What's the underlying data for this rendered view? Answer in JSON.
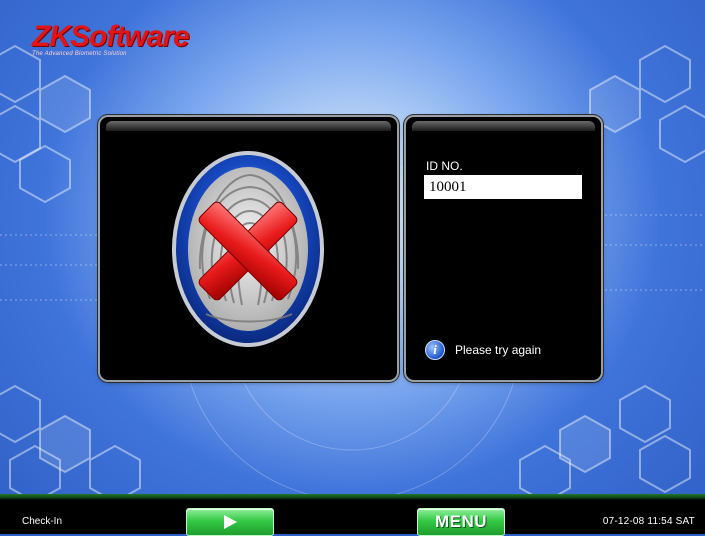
{
  "brand": {
    "name": "ZKSoftware",
    "tagline": "The Advanced Biometric Solution"
  },
  "result_panel": {
    "state": "verification-failed",
    "icon": "fingerprint-reject-icon"
  },
  "id_panel": {
    "label": "ID NO.",
    "value": "10001"
  },
  "status": {
    "icon": "info-icon",
    "message": "Please try again"
  },
  "footer": {
    "mode": "Check-In",
    "next_icon": "play-arrow-icon",
    "menu_label": "MENU",
    "datetime": "07-12-08 11:54 SAT"
  },
  "colors": {
    "brand_red": "#e01616",
    "button_green": "#35c946",
    "panel": "#000000"
  }
}
